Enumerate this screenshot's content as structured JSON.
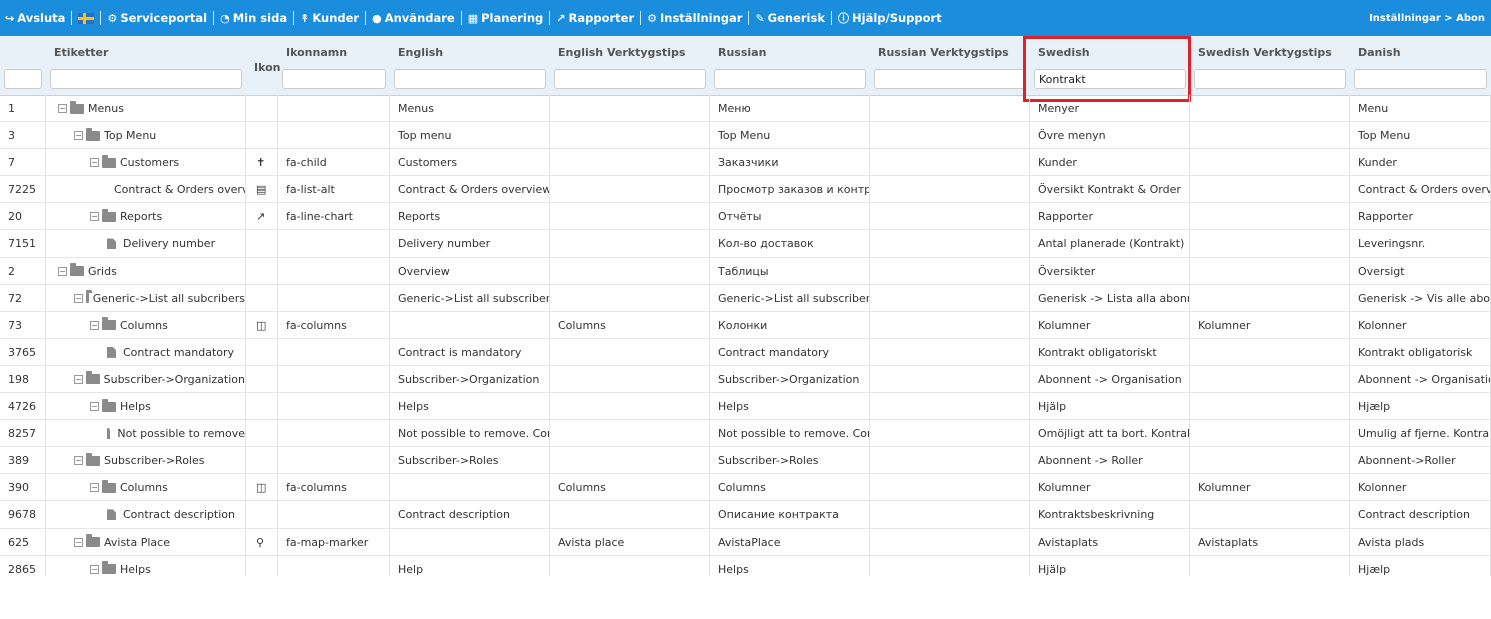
{
  "nav": {
    "items": [
      {
        "icon": "↪",
        "label": "Avsluta"
      },
      {
        "icon": "flag",
        "label": ""
      },
      {
        "icon": "⚙",
        "label": "Serviceportal"
      },
      {
        "icon": "◔",
        "label": "Min sida"
      },
      {
        "icon": "↟",
        "label": "Kunder"
      },
      {
        "icon": "●",
        "label": "Användare"
      },
      {
        "icon": "▦",
        "label": "Planering"
      },
      {
        "icon": "↗",
        "label": "Rapporter"
      },
      {
        "icon": "⚙",
        "label": "Inställningar"
      },
      {
        "icon": "✎",
        "label": "Generisk"
      },
      {
        "icon": "ⓘ",
        "label": "Hjälp/Support"
      }
    ],
    "breadcrumb": "Inställningar > Abon"
  },
  "columns": [
    {
      "label": "",
      "filter": ""
    },
    {
      "label": "Etiketter",
      "filter": ""
    },
    {
      "label": "Ikon",
      "filter": ""
    },
    {
      "label": "Ikonnamn",
      "filter": ""
    },
    {
      "label": "English",
      "filter": ""
    },
    {
      "label": "English Verktygstips",
      "filter": ""
    },
    {
      "label": "Russian",
      "filter": ""
    },
    {
      "label": "Russian Verktygstips",
      "filter": ""
    },
    {
      "label": "Swedish",
      "filter": "Kontrakt"
    },
    {
      "label": "Swedish Verktygstips",
      "filter": ""
    },
    {
      "label": "Danish",
      "filter": ""
    }
  ],
  "rows": [
    {
      "id": "1",
      "level": 0,
      "type": "folder",
      "label": "Menus",
      "icon": "",
      "iconName": "",
      "english": "Menus",
      "englishTip": "",
      "russian": "Меню",
      "russianTip": "",
      "swedish": "Menyer",
      "swedishTip": "",
      "danish": "Menu"
    },
    {
      "id": "3",
      "level": 1,
      "type": "folder",
      "label": "Top Menu",
      "icon": "",
      "iconName": "",
      "english": "Top menu",
      "englishTip": "",
      "russian": "Top Menu",
      "russianTip": "",
      "swedish": "Övre menyn",
      "swedishTip": "",
      "danish": "Top Menu"
    },
    {
      "id": "7",
      "level": 2,
      "type": "folder",
      "label": "Customers",
      "icon": "child-icon",
      "iconName": "fa-child",
      "english": "Customers",
      "englishTip": "",
      "russian": "Заказчики",
      "russianTip": "",
      "swedish": "Kunder",
      "swedishTip": "",
      "danish": "Kunder"
    },
    {
      "id": "7225",
      "level": 3,
      "type": "file",
      "label": "Contract & Orders overview",
      "icon": "list-alt-icon",
      "iconName": "fa-list-alt",
      "english": "Contract & Orders overview",
      "englishTip": "",
      "russian": "Просмотр заказов и контрактов",
      "russianTip": "",
      "swedish": "Översikt Kontrakt & Order",
      "swedishTip": "",
      "danish": "Contract & Orders overview"
    },
    {
      "id": "20",
      "level": 2,
      "type": "folder",
      "label": "Reports",
      "icon": "line-chart-icon",
      "iconName": "fa-line-chart",
      "english": "Reports",
      "englishTip": "",
      "russian": "Отчёты",
      "russianTip": "",
      "swedish": "Rapporter",
      "swedishTip": "",
      "danish": "Rapporter"
    },
    {
      "id": "7151",
      "level": 3,
      "type": "file",
      "label": "Delivery number",
      "icon": "",
      "iconName": "",
      "english": "Delivery number",
      "englishTip": "",
      "russian": "Кол-во доставок",
      "russianTip": "",
      "swedish": "Antal planerade (Kontrakt)",
      "swedishTip": "",
      "danish": "Leveringsnr."
    },
    {
      "id": "2",
      "level": 0,
      "type": "folder",
      "label": "Grids",
      "icon": "",
      "iconName": "",
      "english": "Overview",
      "englishTip": "",
      "russian": "Таблицы",
      "russianTip": "",
      "swedish": "Översikter",
      "swedishTip": "",
      "danish": "Oversigt"
    },
    {
      "id": "72",
      "level": 1,
      "type": "folder",
      "label": "Generic->List all subcribers",
      "icon": "",
      "iconName": "",
      "english": "Generic->List all subscribers",
      "englishTip": "",
      "russian": "Generic->List all subscribers",
      "russianTip": "",
      "swedish": "Generisk -> Lista alla abonnenter",
      "swedishTip": "",
      "danish": "Generisk -> Vis alle abonnenter"
    },
    {
      "id": "73",
      "level": 2,
      "type": "folder",
      "label": "Columns",
      "icon": "columns-icon",
      "iconName": "fa-columns",
      "english": "",
      "englishTip": "Columns",
      "russian": "Колонки",
      "russianTip": "",
      "swedish": "Kolumner",
      "swedishTip": "Kolumner",
      "danish": "Kolonner"
    },
    {
      "id": "3765",
      "level": 3,
      "type": "file",
      "label": "Contract mandatory",
      "icon": "",
      "iconName": "",
      "english": "Contract is mandatory",
      "englishTip": "",
      "russian": "Contract mandatory",
      "russianTip": "",
      "swedish": "Kontrakt obligatoriskt",
      "swedishTip": "",
      "danish": "Kontrakt obligatorisk"
    },
    {
      "id": "198",
      "level": 1,
      "type": "folder",
      "label": "Subscriber->Organization",
      "icon": "",
      "iconName": "",
      "english": "Subscriber->Organization",
      "englishTip": "",
      "russian": "Subscriber->Organization",
      "russianTip": "",
      "swedish": "Abonnent -> Organisation",
      "swedishTip": "",
      "danish": "Abonnent -> Organisation"
    },
    {
      "id": "4726",
      "level": 2,
      "type": "folder",
      "label": "Helps",
      "icon": "",
      "iconName": "",
      "english": "Helps",
      "englishTip": "",
      "russian": "Helps",
      "russianTip": "",
      "swedish": "Hjälp",
      "swedishTip": "",
      "danish": "Hjælp"
    },
    {
      "id": "8257",
      "level": 3,
      "type": "file",
      "label": "Not possible to remove",
      "icon": "",
      "iconName": "",
      "english": "Not possible to remove. Contract",
      "englishTip": "",
      "russian": "Not possible to remove. Contract",
      "russianTip": "",
      "swedish": "Omöjligt att ta bort. Kontrakt %",
      "swedishTip": "",
      "danish": "Umulig af fjerne. Kontrakt"
    },
    {
      "id": "389",
      "level": 1,
      "type": "folder",
      "label": "Subscriber->Roles",
      "icon": "",
      "iconName": "",
      "english": "Subscriber->Roles",
      "englishTip": "",
      "russian": "Subscriber->Roles",
      "russianTip": "",
      "swedish": "Abonnent -> Roller",
      "swedishTip": "",
      "danish": "Abonnent->Roller"
    },
    {
      "id": "390",
      "level": 2,
      "type": "folder",
      "label": "Columns",
      "icon": "columns-icon",
      "iconName": "fa-columns",
      "english": "",
      "englishTip": "Columns",
      "russian": "Columns",
      "russianTip": "",
      "swedish": "Kolumner",
      "swedishTip": "Kolumner",
      "danish": "Kolonner"
    },
    {
      "id": "9678",
      "level": 3,
      "type": "file",
      "label": "Contract description",
      "icon": "",
      "iconName": "",
      "english": "Contract description",
      "englishTip": "",
      "russian": "Описание контракта",
      "russianTip": "",
      "swedish": "Kontraktsbeskrivning",
      "swedishTip": "",
      "danish": "Contract description"
    },
    {
      "id": "625",
      "level": 1,
      "type": "folder",
      "label": "Avista Place",
      "icon": "map-marker-icon",
      "iconName": "fa-map-marker",
      "english": "",
      "englishTip": "Avista place",
      "russian": "AvistaPlace",
      "russianTip": "",
      "swedish": "Avistaplats",
      "swedishTip": "Avistaplats",
      "danish": "Avista plads"
    },
    {
      "id": "2865",
      "level": 2,
      "type": "folder",
      "label": "Helps",
      "icon": "",
      "iconName": "",
      "english": "Help",
      "englishTip": "",
      "russian": "Helps",
      "russianTip": "",
      "swedish": "Hjälp",
      "swedishTip": "",
      "danish": "Hjælp"
    }
  ],
  "colors": {
    "navbar": "#1b8ddd",
    "header": "#e8f1f8",
    "highlight": "#e0202a"
  }
}
